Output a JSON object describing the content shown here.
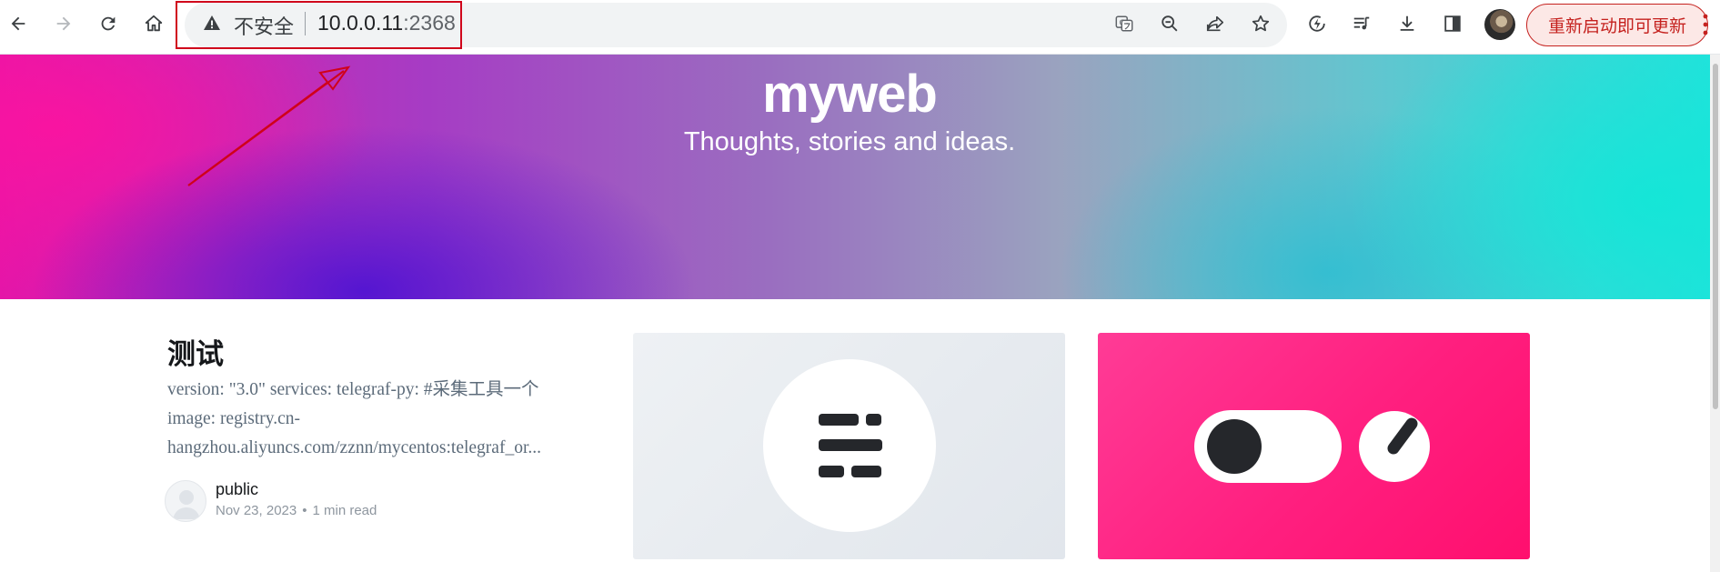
{
  "browser": {
    "security_label": "不安全",
    "url_host": "10.0.0.11",
    "url_port": ":2368",
    "restart_button": "重新启动即可更新",
    "nav": [
      "back-icon",
      "forward-icon",
      "reload-icon",
      "home-icon"
    ],
    "toolbar_icons": [
      "translate-icon",
      "zoom-out-icon",
      "share-icon",
      "bookmark-star-icon",
      "performance-icon",
      "media-queue-icon",
      "download-icon",
      "side-panel-icon",
      "profile-avatar-icon",
      "menu-icon"
    ]
  },
  "hero": {
    "title": "myweb",
    "description": "Thoughts, stories and ideas."
  },
  "post": {
    "title": "测试",
    "excerpt_lines": [
      "version: \"3.0\" services: telegraf-py: #采集工具一个",
      "image: registry.cn-",
      "hangzhou.aliyuncs.com/zznn/mycentos:telegraf_or..."
    ],
    "author": "public",
    "date": "Nov 23, 2023",
    "separator": "•",
    "read_time": "1 min read"
  },
  "colors": {
    "annotation": "#d0021b",
    "pink_card": "#ff1f7f",
    "grey_card": "#e8ecf0"
  }
}
